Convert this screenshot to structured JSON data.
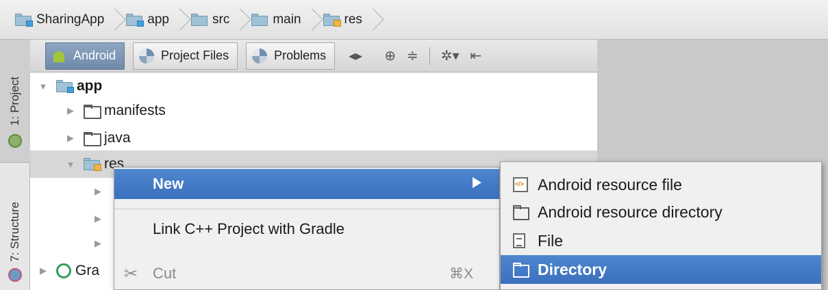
{
  "breadcrumb": {
    "items": [
      {
        "label": "SharingApp",
        "icon": "module-folder-icon"
      },
      {
        "label": "app",
        "icon": "module-folder-icon"
      },
      {
        "label": "src",
        "icon": "folder-icon"
      },
      {
        "label": "main",
        "icon": "folder-icon"
      },
      {
        "label": "res",
        "icon": "resource-folder-icon"
      }
    ]
  },
  "left_strip": {
    "project_tab": "1: Project",
    "structure_tab": "7: Structure"
  },
  "toolbar": {
    "tabs": [
      {
        "label": "Android",
        "icon": "android-icon",
        "active": true
      },
      {
        "label": "Project Files",
        "icon": "pie-icon",
        "active": false
      },
      {
        "label": "Problems",
        "icon": "pie-icon",
        "active": false
      }
    ],
    "glyphs": {
      "switch": "◂▸",
      "locate": "⊕",
      "collapse": "≑",
      "settings": "✲▾",
      "hide": "⇤"
    }
  },
  "tree": {
    "root": "app",
    "children": [
      "manifests",
      "java",
      "res"
    ],
    "gradle_partial": "Gra"
  },
  "context_menu": {
    "new_label": "New",
    "link_label": "Link C++ Project with Gradle",
    "cut_label": "Cut",
    "cut_shortcut": "⌘X"
  },
  "submenu": {
    "items": [
      {
        "label": "Android resource file",
        "icon": "resource-file-icon",
        "highlighted": false
      },
      {
        "label": "Android resource directory",
        "icon": "folder-icon",
        "highlighted": false
      },
      {
        "label": "File",
        "icon": "file-icon",
        "highlighted": false
      },
      {
        "label": "Directory",
        "icon": "folder-icon",
        "highlighted": true
      }
    ]
  },
  "colors": {
    "highlight": "#3b70bd",
    "active_tab": "#7b94b3",
    "android_green": "#a4c639"
  }
}
